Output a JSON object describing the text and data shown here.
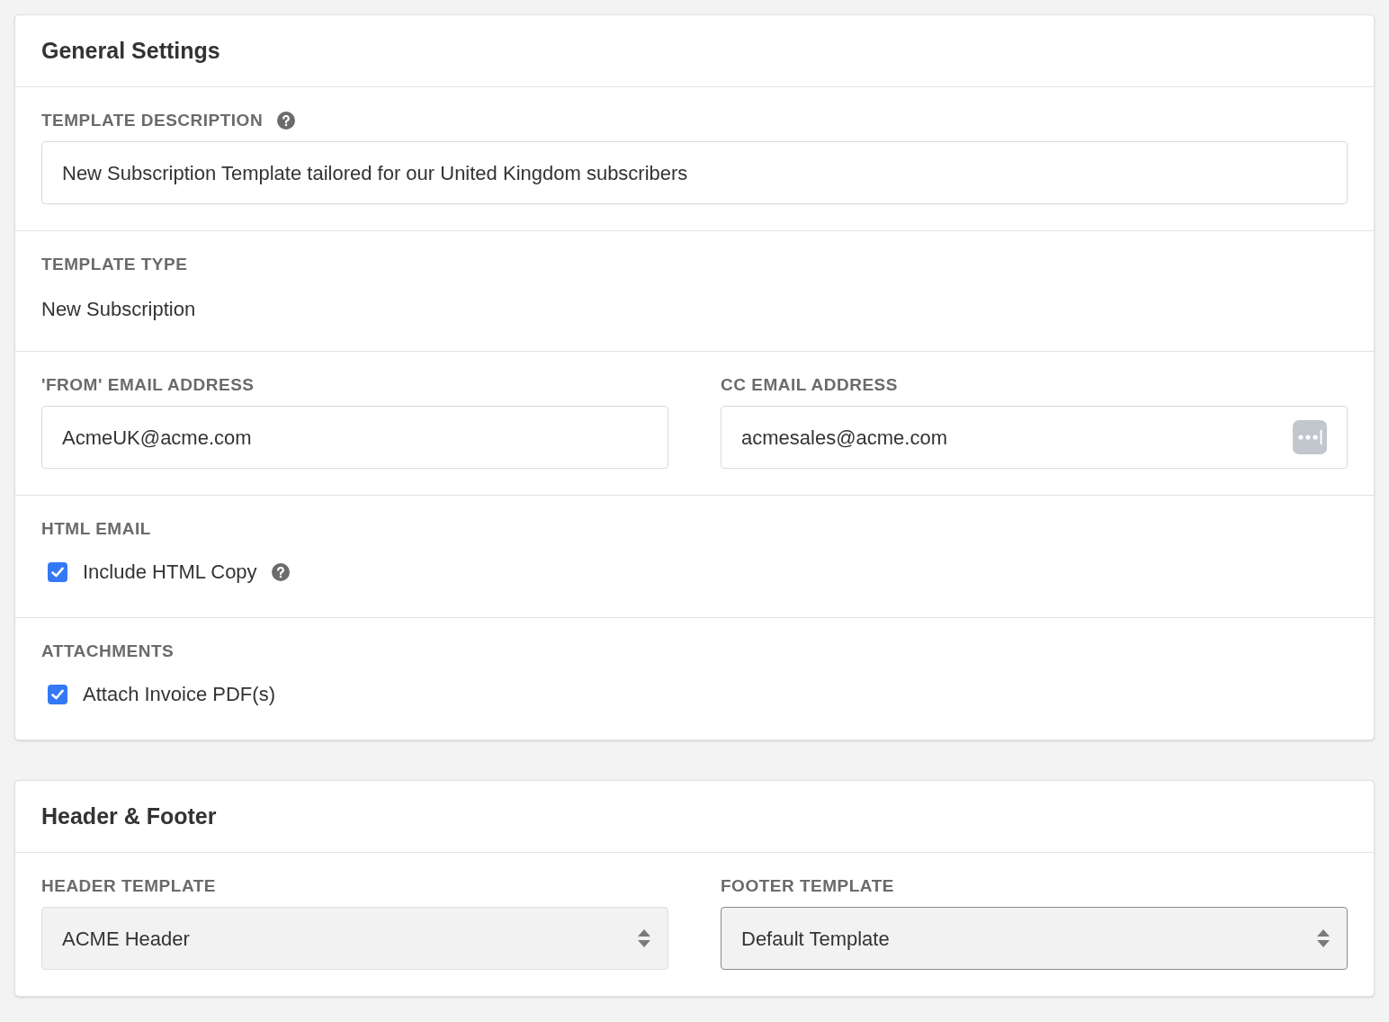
{
  "cards": [
    {
      "title": "General Settings",
      "rows": [
        {
          "kind": "field",
          "label": "TEMPLATE DESCRIPTION",
          "help": true,
          "value": "New Subscription Template tailored for our United Kingdom subscribers"
        },
        {
          "kind": "text",
          "label": "TEMPLATE TYPE",
          "value": "New Subscription"
        },
        {
          "kind": "fields",
          "columns": [
            {
              "label": "'FROM' EMAIL ADDRESS",
              "value": "AcmeUK@acme.com",
              "autofill": false
            },
            {
              "label": "CC EMAIL ADDRESS",
              "value": "acmesales@acme.com",
              "autofill": true
            }
          ]
        },
        {
          "kind": "checkbox",
          "label": "HTML EMAIL",
          "option": {
            "label": "Include HTML Copy",
            "checked": true,
            "help": true
          }
        },
        {
          "kind": "checkbox",
          "label": "ATTACHMENTS",
          "option": {
            "label": "Attach Invoice PDF(s)",
            "checked": true,
            "help": false
          }
        }
      ]
    },
    {
      "title": "Header & Footer",
      "rows": [
        {
          "kind": "selects",
          "columns": [
            {
              "label": "HEADER TEMPLATE",
              "value": "ACME Header",
              "focused": false
            },
            {
              "label": "FOOTER TEMPLATE",
              "value": "Default Template",
              "focused": true
            }
          ]
        }
      ]
    }
  ]
}
